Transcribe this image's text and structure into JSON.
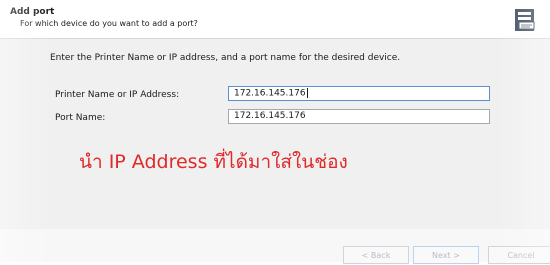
{
  "header": {
    "title": "Add port",
    "subtitle": "For which device do you want to add a port?"
  },
  "instruction": "Enter the Printer Name or IP address, and a port name for the desired device.",
  "fields": {
    "printer_label": "Printer Name or IP Address:",
    "printer_value": "172.16.145.176",
    "port_label": "Port Name:",
    "port_value": "172.16.145.176"
  },
  "annotation": "นำ IP Address ที่ได้มาใส่ในช่อง",
  "buttons": {
    "back": "< Back",
    "next": "Next >",
    "cancel": "Cancel"
  },
  "icons": {
    "wizard": "printer-wizard-icon"
  },
  "colors": {
    "annotation": "#e02a2a",
    "focus_border": "#5a8fd6"
  }
}
